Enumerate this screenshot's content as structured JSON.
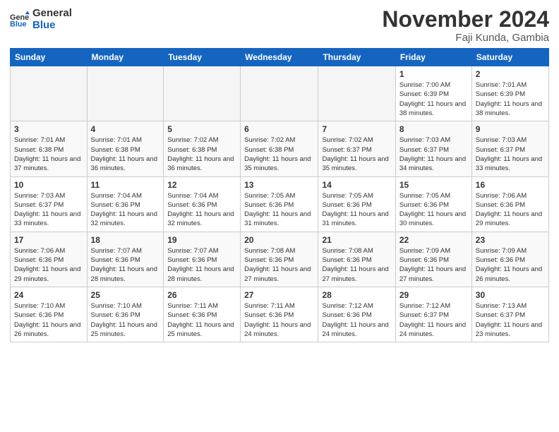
{
  "header": {
    "logo_general": "General",
    "logo_blue": "Blue",
    "month_title": "November 2024",
    "location": "Faji Kunda, Gambia"
  },
  "weekdays": [
    "Sunday",
    "Monday",
    "Tuesday",
    "Wednesday",
    "Thursday",
    "Friday",
    "Saturday"
  ],
  "weeks": [
    [
      {
        "day": "",
        "info": ""
      },
      {
        "day": "",
        "info": ""
      },
      {
        "day": "",
        "info": ""
      },
      {
        "day": "",
        "info": ""
      },
      {
        "day": "",
        "info": ""
      },
      {
        "day": "1",
        "info": "Sunrise: 7:00 AM\nSunset: 6:39 PM\nDaylight: 11 hours\nand 38 minutes."
      },
      {
        "day": "2",
        "info": "Sunrise: 7:01 AM\nSunset: 6:39 PM\nDaylight: 11 hours\nand 38 minutes."
      }
    ],
    [
      {
        "day": "3",
        "info": "Sunrise: 7:01 AM\nSunset: 6:38 PM\nDaylight: 11 hours\nand 37 minutes."
      },
      {
        "day": "4",
        "info": "Sunrise: 7:01 AM\nSunset: 6:38 PM\nDaylight: 11 hours\nand 36 minutes."
      },
      {
        "day": "5",
        "info": "Sunrise: 7:02 AM\nSunset: 6:38 PM\nDaylight: 11 hours\nand 36 minutes."
      },
      {
        "day": "6",
        "info": "Sunrise: 7:02 AM\nSunset: 6:38 PM\nDaylight: 11 hours\nand 35 minutes."
      },
      {
        "day": "7",
        "info": "Sunrise: 7:02 AM\nSunset: 6:37 PM\nDaylight: 11 hours\nand 35 minutes."
      },
      {
        "day": "8",
        "info": "Sunrise: 7:03 AM\nSunset: 6:37 PM\nDaylight: 11 hours\nand 34 minutes."
      },
      {
        "day": "9",
        "info": "Sunrise: 7:03 AM\nSunset: 6:37 PM\nDaylight: 11 hours\nand 33 minutes."
      }
    ],
    [
      {
        "day": "10",
        "info": "Sunrise: 7:03 AM\nSunset: 6:37 PM\nDaylight: 11 hours\nand 33 minutes."
      },
      {
        "day": "11",
        "info": "Sunrise: 7:04 AM\nSunset: 6:36 PM\nDaylight: 11 hours\nand 32 minutes."
      },
      {
        "day": "12",
        "info": "Sunrise: 7:04 AM\nSunset: 6:36 PM\nDaylight: 11 hours\nand 32 minutes."
      },
      {
        "day": "13",
        "info": "Sunrise: 7:05 AM\nSunset: 6:36 PM\nDaylight: 11 hours\nand 31 minutes."
      },
      {
        "day": "14",
        "info": "Sunrise: 7:05 AM\nSunset: 6:36 PM\nDaylight: 11 hours\nand 31 minutes."
      },
      {
        "day": "15",
        "info": "Sunrise: 7:05 AM\nSunset: 6:36 PM\nDaylight: 11 hours\nand 30 minutes."
      },
      {
        "day": "16",
        "info": "Sunrise: 7:06 AM\nSunset: 6:36 PM\nDaylight: 11 hours\nand 29 minutes."
      }
    ],
    [
      {
        "day": "17",
        "info": "Sunrise: 7:06 AM\nSunset: 6:36 PM\nDaylight: 11 hours\nand 29 minutes."
      },
      {
        "day": "18",
        "info": "Sunrise: 7:07 AM\nSunset: 6:36 PM\nDaylight: 11 hours\nand 28 minutes."
      },
      {
        "day": "19",
        "info": "Sunrise: 7:07 AM\nSunset: 6:36 PM\nDaylight: 11 hours\nand 28 minutes."
      },
      {
        "day": "20",
        "info": "Sunrise: 7:08 AM\nSunset: 6:36 PM\nDaylight: 11 hours\nand 27 minutes."
      },
      {
        "day": "21",
        "info": "Sunrise: 7:08 AM\nSunset: 6:36 PM\nDaylight: 11 hours\nand 27 minutes."
      },
      {
        "day": "22",
        "info": "Sunrise: 7:09 AM\nSunset: 6:36 PM\nDaylight: 11 hours\nand 27 minutes."
      },
      {
        "day": "23",
        "info": "Sunrise: 7:09 AM\nSunset: 6:36 PM\nDaylight: 11 hours\nand 26 minutes."
      }
    ],
    [
      {
        "day": "24",
        "info": "Sunrise: 7:10 AM\nSunset: 6:36 PM\nDaylight: 11 hours\nand 26 minutes."
      },
      {
        "day": "25",
        "info": "Sunrise: 7:10 AM\nSunset: 6:36 PM\nDaylight: 11 hours\nand 25 minutes."
      },
      {
        "day": "26",
        "info": "Sunrise: 7:11 AM\nSunset: 6:36 PM\nDaylight: 11 hours\nand 25 minutes."
      },
      {
        "day": "27",
        "info": "Sunrise: 7:11 AM\nSunset: 6:36 PM\nDaylight: 11 hours\nand 24 minutes."
      },
      {
        "day": "28",
        "info": "Sunrise: 7:12 AM\nSunset: 6:36 PM\nDaylight: 11 hours\nand 24 minutes."
      },
      {
        "day": "29",
        "info": "Sunrise: 7:12 AM\nSunset: 6:37 PM\nDaylight: 11 hours\nand 24 minutes."
      },
      {
        "day": "30",
        "info": "Sunrise: 7:13 AM\nSunset: 6:37 PM\nDaylight: 11 hours\nand 23 minutes."
      }
    ]
  ]
}
